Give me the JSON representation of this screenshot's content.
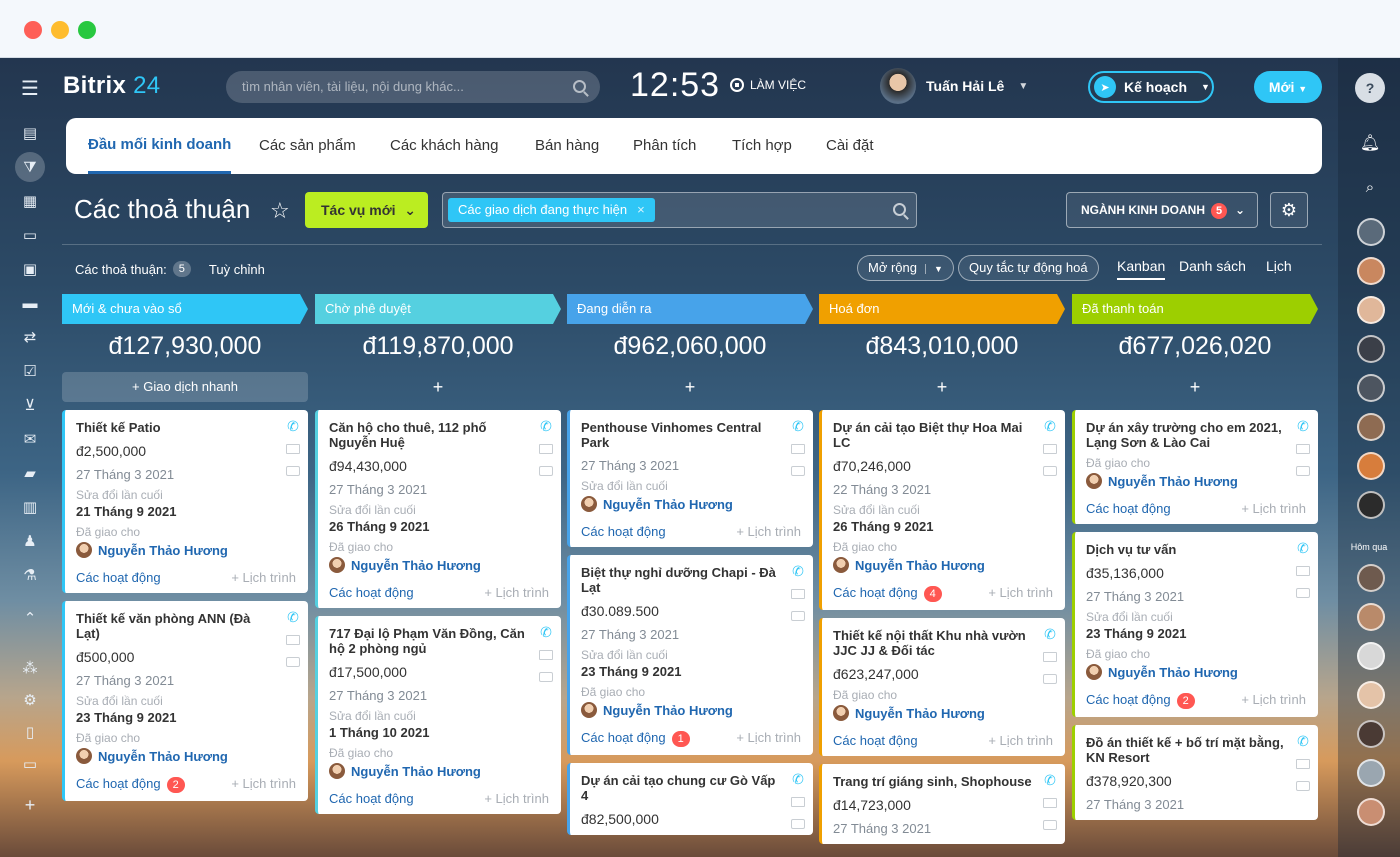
{
  "app": {
    "logo": "Bitrix",
    "logo_num": "24"
  },
  "search": {
    "placeholder": "tìm nhân viên, tài liệu, nội dung khác..."
  },
  "clock": {
    "time": "12:53",
    "status": "LÀM VIỆC"
  },
  "user": {
    "name": "Tuấn Hải Lê"
  },
  "header": {
    "plan_label": "Kế hoạch",
    "new_label": "Mới"
  },
  "tabs": [
    {
      "label": "Đầu mối kinh doanh"
    },
    {
      "label": "Các sản phẩm"
    },
    {
      "label": "Các khách hàng"
    },
    {
      "label": "Bán hàng"
    },
    {
      "label": "Phân tích"
    },
    {
      "label": "Tích hợp"
    },
    {
      "label": "Cài đặt"
    }
  ],
  "page": {
    "title": "Các thoả thuận",
    "new_task": "Tác vụ mới",
    "filter_chip": "Các giao dịch đang thực hiện",
    "sector_label": "NGÀNH KINH DOANH",
    "sector_count": "5",
    "deals_label": "Các thoả thuận:",
    "deals_count": "5",
    "customize": "Tuỳ chỉnh",
    "expand": "Mở rộng",
    "automation": "Quy tắc tự động hoá",
    "views": [
      "Kanban",
      "Danh sách",
      "Lịch"
    ]
  },
  "right_sidebar": {
    "yesterday": "Hôm qua"
  },
  "columns": [
    {
      "name": "Mới & chưa vào sổ",
      "total": "đ127,930,000",
      "color": "#2fc6f6",
      "quick_add": "Giao dịch nhanh",
      "cards": [
        {
          "title": "Thiết kế Patio",
          "price": "đ2,500,000",
          "date": "27 Tháng 3 2021",
          "mod_label": "Sửa đổi lần cuối",
          "mod_date": "21 Tháng 9 2021",
          "assign_label": "Đã giao cho",
          "person": "Nguyễn Thảo Hương",
          "activities": "Các hoạt động",
          "schedule": "+ Lịch trình",
          "count": ""
        },
        {
          "title": "Thiết kế văn phòng ANN (Đà Lạt)",
          "price": "đ500,000",
          "date": "27 Tháng 3 2021",
          "mod_label": "Sửa đổi lần cuối",
          "mod_date": "23 Tháng 9 2021",
          "assign_label": "Đã giao cho",
          "person": "Nguyễn Thảo Hương",
          "activities": "Các hoạt động",
          "schedule": "+ Lịch trình",
          "count": "2"
        }
      ]
    },
    {
      "name": "Chờ phê duyệt",
      "total": "đ119,870,000",
      "color": "#55d0e0",
      "quick_add": "+",
      "cards": [
        {
          "title": "Căn hộ cho thuê, 112 phố Nguyễn Huệ",
          "price": "đ94,430,000",
          "date": "27 Tháng 3 2021",
          "mod_label": "Sửa đổi lần cuối",
          "mod_date": "26 Tháng 9 2021",
          "assign_label": "Đã giao cho",
          "person": "Nguyễn Thảo Hương",
          "activities": "Các hoạt động",
          "schedule": "+ Lịch trình",
          "count": ""
        },
        {
          "title": "717 Đại lộ Phạm Văn Đồng, Căn hộ 2 phòng ngủ",
          "price": "đ17,500,000",
          "date": "27 Tháng 3 2021",
          "mod_label": "Sửa đổi lần cuối",
          "mod_date": "1 Tháng 10 2021",
          "assign_label": "Đã giao cho",
          "person": "Nguyễn Thảo Hương",
          "activities": "Các hoạt động",
          "schedule": "+ Lịch trình",
          "count": ""
        }
      ]
    },
    {
      "name": "Đang diễn ra",
      "total": "đ962,060,000",
      "color": "#47a3ea",
      "quick_add": "+",
      "cards": [
        {
          "title": "Penthouse Vinhomes Central Park",
          "price": "",
          "date": "27 Tháng 3 2021",
          "mod_label": "Sửa đổi lần cuối",
          "mod_date": "",
          "assign_label": "",
          "person": "Nguyễn Thảo Hương",
          "activities": "Các hoạt động",
          "schedule": "+ Lịch trình",
          "count": ""
        },
        {
          "title": "Biệt thự nghỉ dưỡng Chapi - Đà Lạt",
          "price": "đ30.089.500",
          "date": "27 Tháng 3 2021",
          "mod_label": "Sửa đổi lần cuối",
          "mod_date": "23 Tháng 9 2021",
          "assign_label": "Đã giao cho",
          "person": "Nguyễn Thảo Hương",
          "activities": "Các hoạt động",
          "schedule": "+ Lịch trình",
          "count": "1"
        },
        {
          "title": "Dự án cải tạo chung cư Gò Vấp 4",
          "price": "đ82,500,000",
          "date": "",
          "mod_label": "",
          "mod_date": "",
          "assign_label": "",
          "person": "",
          "activities": "",
          "schedule": "",
          "count": ""
        }
      ]
    },
    {
      "name": "Hoá đơn",
      "total": "đ843,010,000",
      "color": "#f0a000",
      "quick_add": "+",
      "cards": [
        {
          "title": "Dự án cải tạo Biệt thự Hoa Mai LC",
          "price": "đ70,246,000",
          "date": "22 Tháng 3 2021",
          "mod_label": "Sửa đổi lần cuối",
          "mod_date": "26 Tháng 9 2021",
          "assign_label": "Đã giao cho",
          "person": "Nguyễn Thảo Hương",
          "activities": "Các hoạt động",
          "schedule": "+ Lịch trình",
          "count": "4"
        },
        {
          "title": "Thiết kế nội thất Khu nhà vườn JJC JJ & Đối tác",
          "price": "đ623,247,000",
          "date": "",
          "mod_label": "",
          "mod_date": "",
          "assign_label": "Đã giao cho",
          "person": "Nguyễn Thảo Hương",
          "activities": "Các hoạt động",
          "schedule": "+ Lịch trình",
          "count": ""
        },
        {
          "title": "Trang trí giáng sinh, Shophouse",
          "price": "đ14,723,000",
          "date": "27 Tháng 3 2021",
          "mod_label": "",
          "mod_date": "",
          "assign_label": "",
          "person": "",
          "activities": "",
          "schedule": "",
          "count": ""
        }
      ]
    },
    {
      "name": "Đã thanh toán",
      "total": "đ677,026,020",
      "color": "#9dcf00",
      "quick_add": "+",
      "cards": [
        {
          "title": "Dự án xây trường cho em 2021, Lạng Sơn & Lào Cai",
          "price": "",
          "date": "",
          "mod_label": "",
          "mod_date": "",
          "assign_label": "Đã giao cho",
          "person": "Nguyễn Thảo Hương",
          "activities": "Các hoạt động",
          "schedule": "+ Lịch trình",
          "count": ""
        },
        {
          "title": "Dịch vụ tư vấn",
          "price": "đ35,136,000",
          "date": "27 Tháng 3 2021",
          "mod_label": "Sửa đổi lần cuối",
          "mod_date": "23 Tháng 9 2021",
          "assign_label": "Đã giao cho",
          "person": "Nguyễn Thảo Hương",
          "activities": "Các hoạt động",
          "schedule": "+ Lịch trình",
          "count": "2"
        },
        {
          "title": "Đồ án thiết kế + bố trí mặt bằng, KN Resort",
          "price": "đ378,920,300",
          "date": "27 Tháng 3 2021",
          "mod_label": "",
          "mod_date": "",
          "assign_label": "",
          "person": "",
          "activities": "",
          "schedule": "",
          "count": ""
        }
      ]
    }
  ]
}
